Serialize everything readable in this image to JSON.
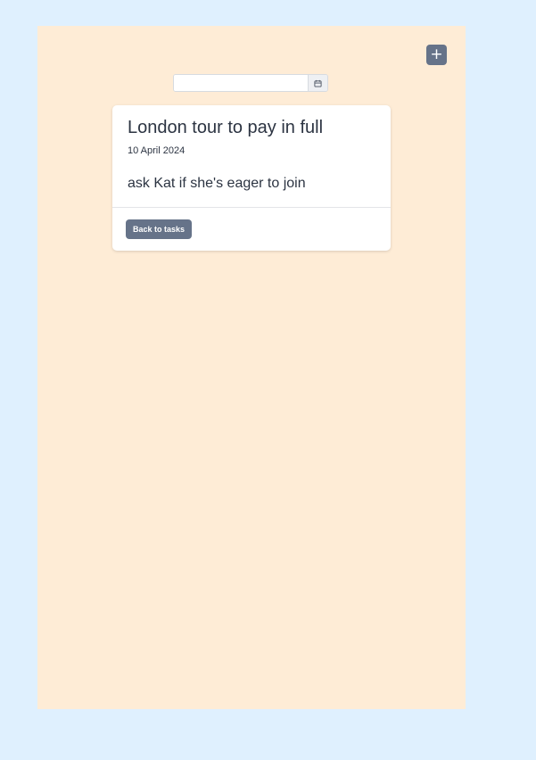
{
  "toolbar": {
    "add_label": "+"
  },
  "date_filter": {
    "value": "",
    "placeholder": ""
  },
  "task": {
    "title": "London tour to pay in full",
    "date": "10 April 2024",
    "note": "ask Kat if she's eager to join",
    "back_label": "Back to tasks"
  },
  "colors": {
    "page_background": "#dff0fe",
    "panel_background": "#feecd6",
    "button_background": "#667389",
    "text": "#2c3442"
  },
  "icons": {
    "add": "plus-icon",
    "calendar": "calendar-icon"
  }
}
